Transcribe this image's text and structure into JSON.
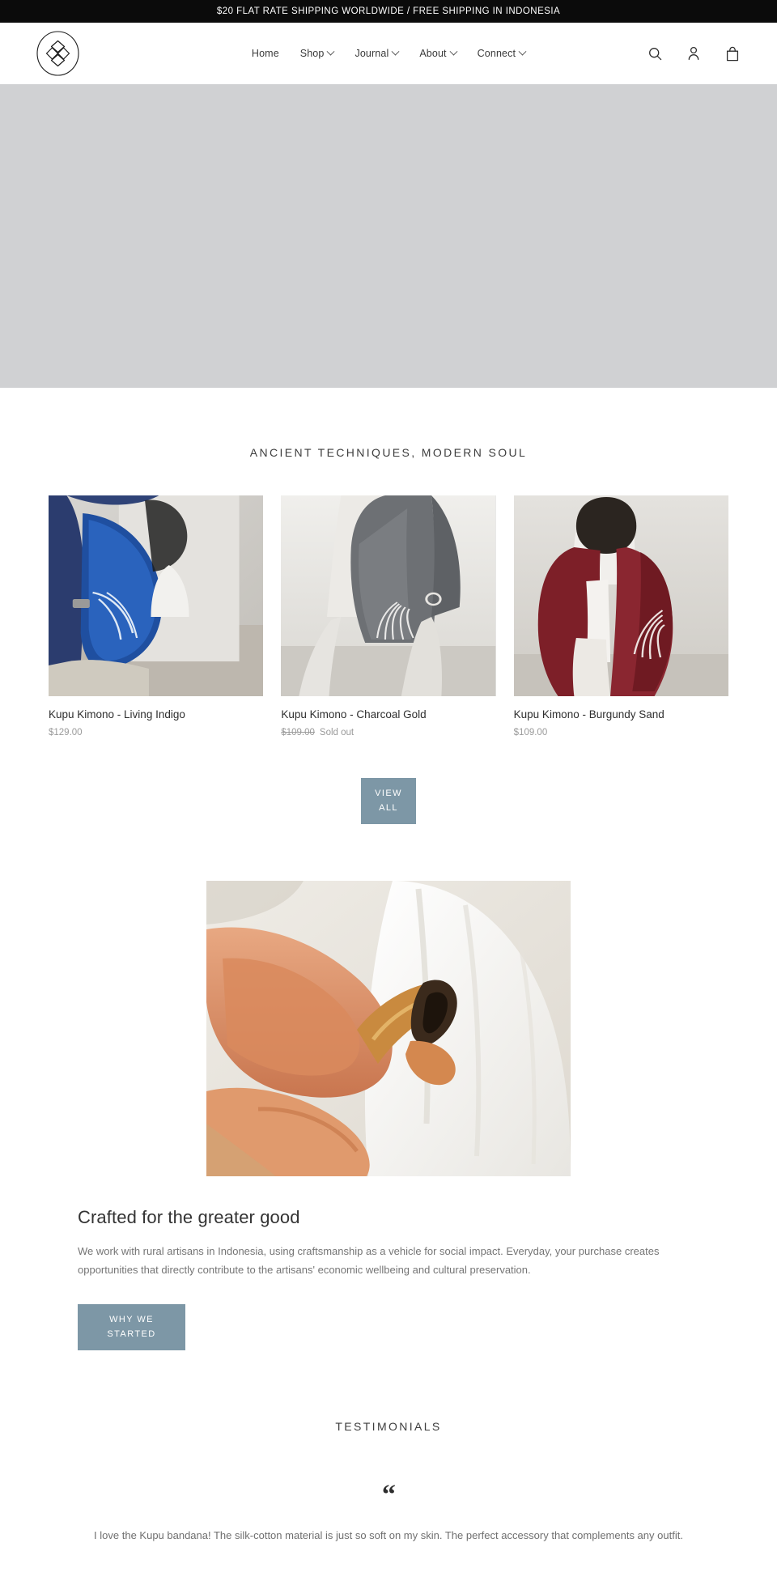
{
  "announcement": {
    "text": "$20 FLAT RATE SHIPPING WORLDWIDE / FREE SHIPPING IN INDONESIA"
  },
  "header": {
    "logo_alt": "Kupu interlaced knot logo",
    "nav": [
      {
        "label": "Home",
        "has_dropdown": false
      },
      {
        "label": "Shop",
        "has_dropdown": true
      },
      {
        "label": "Journal",
        "has_dropdown": true
      },
      {
        "label": "About",
        "has_dropdown": true
      },
      {
        "label": "Connect",
        "has_dropdown": true
      }
    ],
    "actions": [
      {
        "name": "search",
        "label": "Search"
      },
      {
        "name": "account",
        "label": "Log in"
      },
      {
        "name": "cart",
        "label": "Cart"
      }
    ]
  },
  "hero": {
    "placeholder_color": "#d0d1d3"
  },
  "featured": {
    "title": "ANCIENT TECHNIQUES, MODERN SOUL",
    "products": [
      {
        "title": "Kupu Kimono - Living Indigo",
        "price": "$129.00",
        "compare_at": "",
        "status": ""
      },
      {
        "title": "Kupu Kimono - Charcoal Gold",
        "price": "",
        "compare_at": "$109.00",
        "status": "Sold out"
      },
      {
        "title": "Kupu Kimono - Burgundy Sand",
        "price": "$109.00",
        "compare_at": "",
        "status": ""
      }
    ],
    "view_all_label": "View all"
  },
  "story": {
    "heading": "Crafted for the greater good",
    "text": "We work with rural artisans in Indonesia, using craftsmanship as a vehicle for social impact. Everyday, your purchase creates opportunities that directly contribute to the artisans' economic wellbeing and cultural preservation.",
    "cta_label": "Why we started"
  },
  "testimonials": {
    "title": "TESTIMONIALS",
    "quote_glyph": "“",
    "quote": "I love the Kupu bandana! The silk-cotton material is just so soft on my skin. The perfect accessory that complements any outfit."
  },
  "theme": {
    "accent": "#7d97a6",
    "announcement_bg": "#0b0b0b",
    "text": "#3a3a3a",
    "muted": "#9a9a9a"
  }
}
